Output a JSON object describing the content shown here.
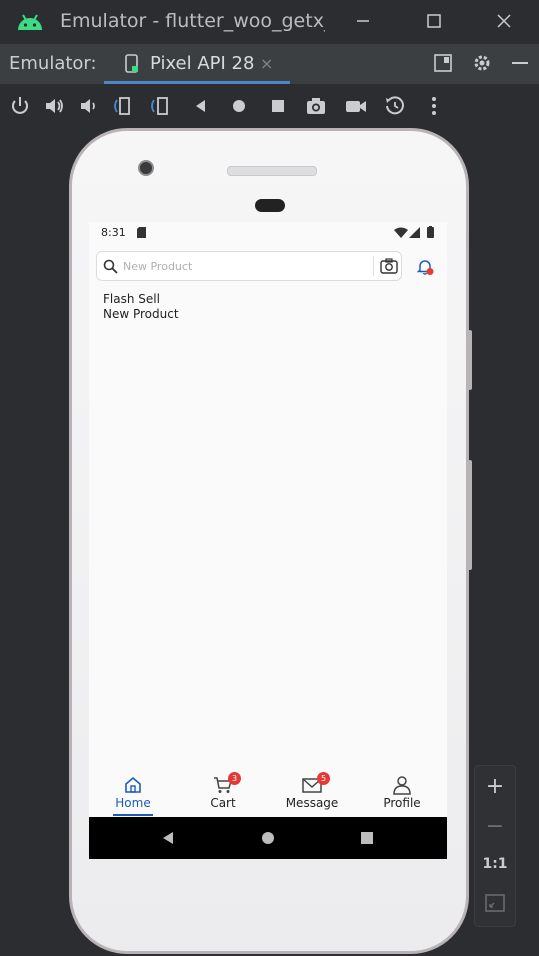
{
  "window": {
    "title": "Emulator - flutter_woo_getx_le",
    "controls": {
      "minimize": "minimize-icon",
      "maximize": "maximize-icon",
      "close": "close-icon"
    }
  },
  "tool_window": {
    "label": "Emulator:",
    "tab": {
      "label": "Pixel API 28",
      "close": "×"
    },
    "actions": [
      "layout-icon",
      "gear-icon",
      "minimize-icon"
    ]
  },
  "toolbar": {
    "buttons": [
      "power-icon",
      "volume-up-icon",
      "volume-down-icon",
      "rotate-left-icon",
      "rotate-right-icon",
      "back-icon",
      "home-icon",
      "overview-icon",
      "screenshot-icon",
      "record-icon",
      "snapshot-icon",
      "more-icon"
    ]
  },
  "device": {
    "status_bar": {
      "time": "8:31"
    },
    "search": {
      "placeholder": "New Product"
    },
    "content": {
      "line1": "Flash Sell",
      "line2": "New Product"
    },
    "bottom_nav": {
      "items": [
        {
          "label": "Home",
          "active": true
        },
        {
          "label": "Cart",
          "badge": "3"
        },
        {
          "label": "Message",
          "badge": "5"
        },
        {
          "label": "Profile"
        }
      ]
    }
  },
  "zoom_panel": {
    "plus": "+",
    "minus": "−",
    "one_to_one": "1:1"
  },
  "colors": {
    "accent": "#4a88c7",
    "active_nav": "#1e5bb8",
    "badge": "#e53935",
    "android_logo": "#3ddc84"
  }
}
